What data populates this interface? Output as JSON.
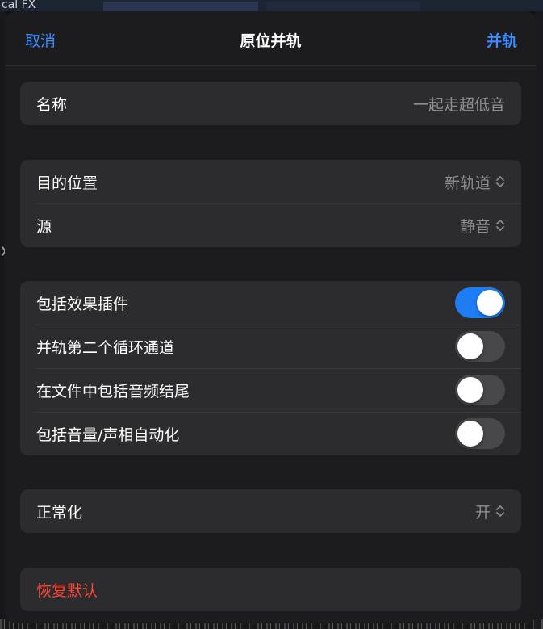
{
  "background": {
    "label": "cal FX"
  },
  "nav": {
    "cancel_label": "取消",
    "title": "原位并轨",
    "confirm_label": "并轨"
  },
  "name_group": {
    "label": "名称",
    "value": "一起走超低音"
  },
  "destination_group": {
    "destination_label": "目的位置",
    "destination_value": "新轨道",
    "source_label": "源",
    "source_value": "静音"
  },
  "options_group": {
    "include_effects_label": "包括效果插件",
    "include_effects_on": true,
    "second_cycle_label": "并轨第二个循环通道",
    "second_cycle_on": false,
    "audio_tail_label": "在文件中包括音频结尾",
    "audio_tail_on": false,
    "automation_label": "包括音量/声相自动化",
    "automation_on": false
  },
  "normalize_group": {
    "label": "正常化",
    "value": "开"
  },
  "reset": {
    "label": "恢复默认"
  },
  "colors": {
    "accent": "#3b8cff",
    "toggle_on": "#1e7cf5",
    "destructive": "#ff453a"
  }
}
